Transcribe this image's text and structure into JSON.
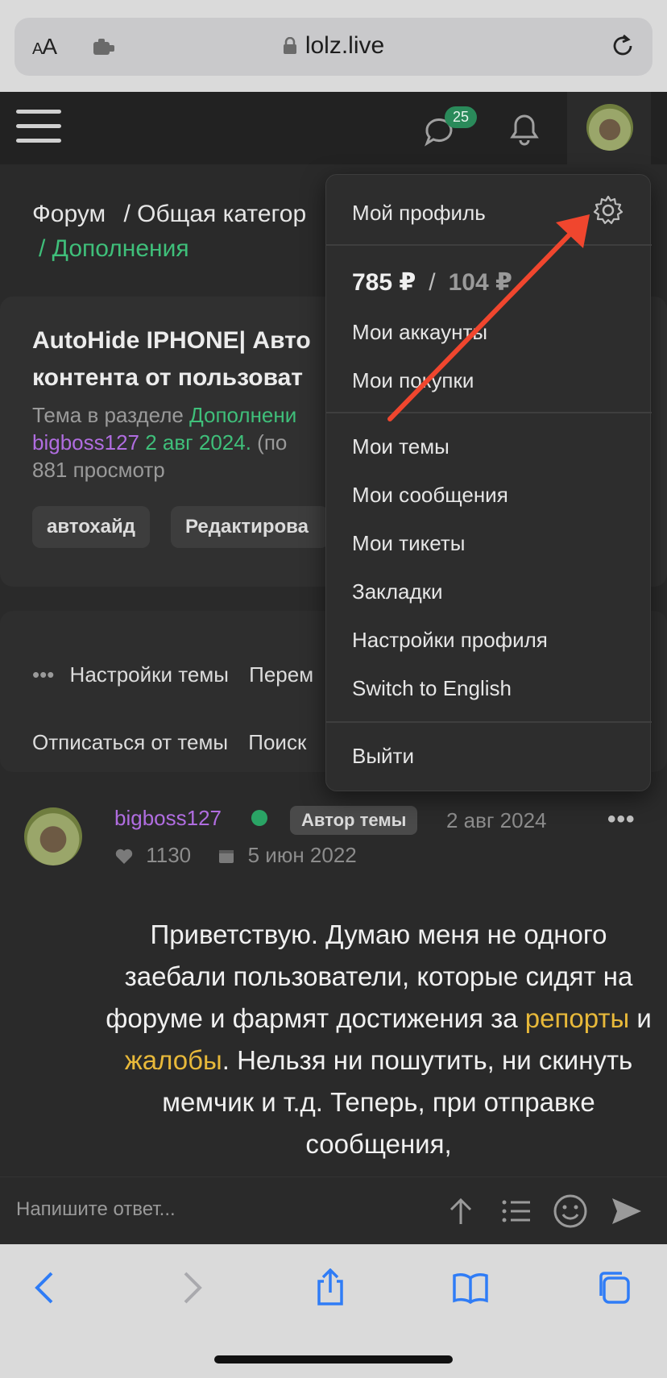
{
  "safari": {
    "aa_label_small": "A",
    "aa_label_large": "A",
    "url": "lolz.live"
  },
  "header": {
    "chat_badge": "25"
  },
  "breadcrumb": {
    "item1": "Форум",
    "item2": "/ Общая категор",
    "item3": "/ Дополнения"
  },
  "thread": {
    "title_line1": "AutoHide IPHONE| Авто",
    "title_line2": "контента от пользоват",
    "meta_prefix": "Тема в разделе ",
    "meta_section": "Дополнени",
    "meta_author": "bigboss127",
    "meta_date": " 2 авг 2024.",
    "meta_suffix": " (по",
    "views": "881 просмотр",
    "tags": [
      "автохайд",
      "Редактирова"
    ]
  },
  "actions": {
    "more": "•••",
    "settings": "Настройки темы",
    "move": "Перем",
    "unsubscribe": "Отписаться от темы",
    "search": "Поиск"
  },
  "post": {
    "username": "bigboss127",
    "author_badge": "Автор темы",
    "date": "2 авг 2024",
    "more": "•••",
    "likes": "1130",
    "joined": "5 июн 2022",
    "body_part1": "Приветствую. Думаю меня не одного заебали пользователи, которые сидят на форуме и фармят достижения за ",
    "link_reports": "репорты",
    "body_and": " и ",
    "link_complaints": "жалобы",
    "body_part2": ". Нельзя ни пошутить, ни скинуть мемчик и т.д. Теперь, при отправке сообщения,"
  },
  "reply": {
    "placeholder": "Напишите ответ..."
  },
  "menu": {
    "my_profile": "Мой профиль",
    "balance_main": "785 ₽",
    "balance_sep": "/",
    "balance_hold": "104 ₽",
    "my_accounts": "Мои аккаунты",
    "my_purchases": "Мои покупки",
    "my_threads": "Мои темы",
    "my_messages": "Мои сообщения",
    "my_tickets": "Мои тикеты",
    "bookmarks": "Закладки",
    "profile_settings": "Настройки профиля",
    "switch_lang": "Switch to English",
    "logout": "Выйти"
  },
  "colors": {
    "accent_green": "#3fbf7a",
    "username_purple": "#b06de0",
    "link_yellow": "#e8b93a",
    "annotation_arrow": "#f0462e"
  }
}
